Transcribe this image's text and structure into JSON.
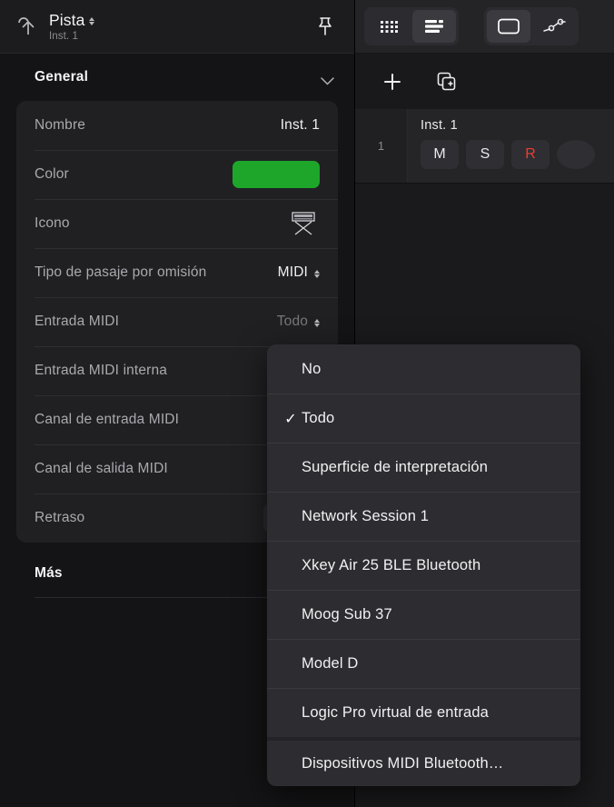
{
  "inspector": {
    "header": {
      "back_icon": "back-arrow-icon",
      "title": "Pista",
      "subtitle": "Inst. 1",
      "pin_icon": "pushpin-icon"
    },
    "section": {
      "title": "General",
      "collapse_icon": "chevron-down-icon"
    },
    "rows": [
      {
        "label": "Nombre",
        "value": "Inst. 1",
        "type": "text"
      },
      {
        "label": "Color",
        "value": "",
        "type": "color",
        "color": "#1da62a"
      },
      {
        "label": "Icono",
        "value": "",
        "type": "icon",
        "icon": "keyboard-stand-icon"
      },
      {
        "label": "Tipo de pasaje por omisión",
        "value": "MIDI",
        "type": "stepper"
      },
      {
        "label": "Entrada MIDI",
        "value": "Todo",
        "type": "stepper",
        "dim": true
      },
      {
        "label": "Entrada MIDI interna",
        "value": "",
        "type": "stepper",
        "dim": true
      },
      {
        "label": "Canal de entrada MIDI",
        "value": "",
        "type": "stepper",
        "dim": true
      },
      {
        "label": "Canal de salida MIDI",
        "value": "",
        "type": "stepper",
        "dim": true
      },
      {
        "label": "Retraso",
        "value": "",
        "type": "field"
      }
    ],
    "more": {
      "title": "Más"
    }
  },
  "toolbar": {
    "buttons": [
      {
        "name": "grid-view-button",
        "icon": "grid-dots-icon",
        "active": false
      },
      {
        "name": "list-view-button",
        "icon": "list-lines-icon",
        "active": true
      },
      {
        "name": "region-view-button",
        "icon": "rounded-rect-icon",
        "active": true
      },
      {
        "name": "automation-button",
        "icon": "automation-node-icon",
        "active": false
      }
    ]
  },
  "track_toolbar": {
    "add_label": "+",
    "add_name": "add-track-button",
    "duplicate_name": "duplicate-track-button"
  },
  "tracks": [
    {
      "number": "1",
      "name": "Inst. 1",
      "buttons": [
        {
          "label": "M",
          "name": "mute-button"
        },
        {
          "label": "S",
          "name": "solo-button"
        },
        {
          "label": "R",
          "name": "record-enable-button",
          "accent": "#f03c2e"
        }
      ]
    }
  ],
  "menu": {
    "items": [
      {
        "label": "No",
        "checked": false,
        "separator": false
      },
      {
        "label": "Todo",
        "checked": true,
        "separator": false
      },
      {
        "label": "Superficie de interpretación",
        "checked": false,
        "separator": false
      },
      {
        "label": "Network Session 1",
        "checked": false,
        "separator": false
      },
      {
        "label": "Xkey Air 25 BLE Bluetooth",
        "checked": false,
        "separator": false
      },
      {
        "label": "Moog Sub 37",
        "checked": false,
        "separator": false
      },
      {
        "label": "Model D",
        "checked": false,
        "separator": false
      },
      {
        "label": "Logic Pro virtual de entrada",
        "checked": false,
        "separator": false
      },
      {
        "label": "Dispositivos MIDI Bluetooth…",
        "checked": false,
        "separator": true
      }
    ],
    "check_glyph": "✓"
  }
}
